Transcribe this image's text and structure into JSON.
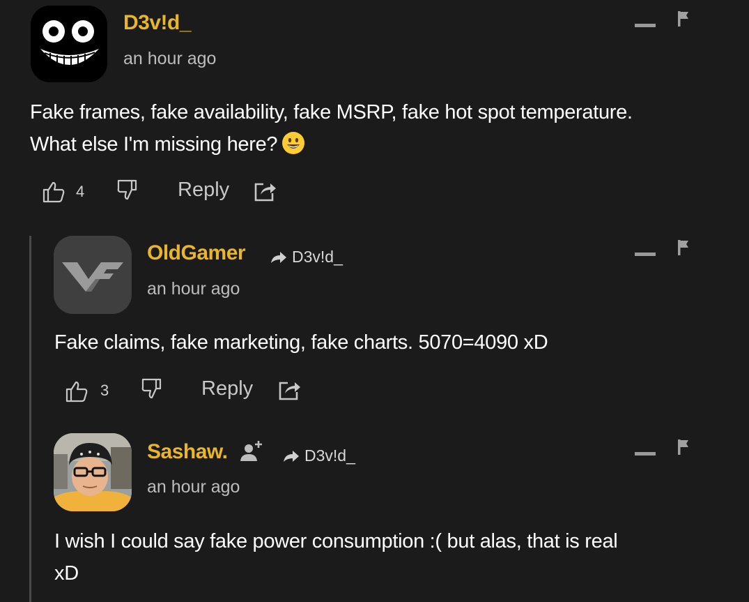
{
  "comments": [
    {
      "username": "D3v!d_",
      "time": "an hour ago",
      "text_line1": "Fake frames, fake availability, fake MSRP, fake hot spot temperature.",
      "text_line2": "What else I'm missing here?",
      "emoji": "grinning-face",
      "likes": "4",
      "reply_label": "Reply"
    },
    {
      "username": "OldGamer",
      "reply_to": "D3v!d_",
      "time": "an hour ago",
      "text_line1": "Fake claims, fake marketing, fake charts. 5070=4090 xD",
      "likes": "3",
      "reply_label": "Reply"
    },
    {
      "username": "Sashaw.",
      "reply_to": "D3v!d_",
      "time": "an hour ago",
      "text_line1": "I wish I could say fake power consumption :( but alas, that is real",
      "text_line2": "xD"
    }
  ],
  "colors": {
    "background": "#1b1b1b",
    "username": "#e8b62a",
    "thread_line": "#4a4a4a"
  }
}
